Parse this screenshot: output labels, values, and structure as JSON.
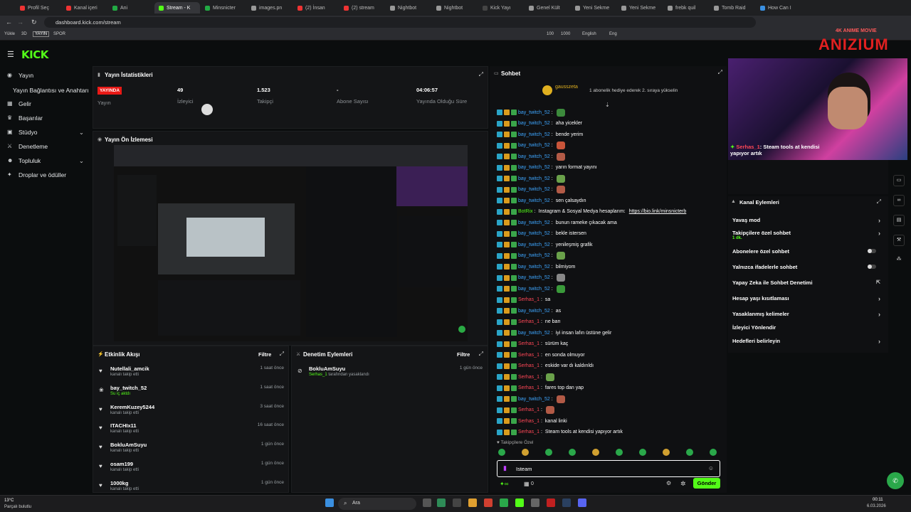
{
  "browser": {
    "tabs": [
      "Profil Seç",
      "Kanal içeri",
      "Ani",
      "Stream - K",
      "Minsnicter",
      "images.pn",
      "(2) İnsan",
      "(2) stream",
      "Nightbot",
      "Nightbot",
      "Kick Yayı",
      "Genel Kült",
      "Yeni Sekme",
      "Yeni Sekme",
      "frebk quil",
      "Tomb Raid",
      "How Can I"
    ],
    "active_tab_index": 3,
    "url": "dashboard.kick.com/stream",
    "bookmarks": [
      "Yükle",
      "3D",
      "YAYIN",
      "SPOR",
      "100",
      "1000",
      "English",
      "Eng"
    ]
  },
  "kick": {
    "logo": "KICK"
  },
  "sidebar": {
    "items": [
      {
        "label": "Yayın",
        "icon": "broadcast-icon"
      },
      {
        "label": "Yayın Bağlantısı ve Anahtarı",
        "icon": ""
      },
      {
        "label": "Gelir",
        "icon": "money-icon"
      },
      {
        "label": "Başarılar",
        "icon": "trophy-icon"
      },
      {
        "label": "Stüdyo",
        "icon": "studio-icon"
      },
      {
        "label": "Denetleme",
        "icon": "sword-icon"
      },
      {
        "label": "Topluluk",
        "icon": "people-icon"
      },
      {
        "label": "Droplar ve ödüller",
        "icon": "gift-icon"
      }
    ]
  },
  "stats": {
    "title": "Yayın İstatistikleri",
    "live_badge": "YAYINDA",
    "live_label": "Yayın",
    "viewers": "49",
    "viewers_label": "İzleyici",
    "followers": "1.523",
    "followers_label": "Takipçi",
    "subs": "-",
    "subs_label": "Abone Sayısı",
    "uptime": "04:06:57",
    "uptime_label": "Yayında Olduğu Süre"
  },
  "preview": {
    "title": "Yayın Ön İzlemesi"
  },
  "activity": {
    "title": "Etkinlik Akışı",
    "filter": "Filtre",
    "items": [
      {
        "name": "Nutellali_amcik",
        "sub": "kanalı takip etti",
        "time": "1 saat önce"
      },
      {
        "name": "bay_twitch_52",
        "sub": "Su iç aktdı",
        "time": "1 saat önce"
      },
      {
        "name": "KeremKuzey5244",
        "sub": "kanalı takip etti",
        "time": "3 saat önce"
      },
      {
        "name": "ITACHIx11",
        "sub": "kanalı takip etti",
        "time": "16 saat önce"
      },
      {
        "name": "BokluAmSuyu",
        "sub": "kanalı takip etti",
        "time": "1 gün önce"
      },
      {
        "name": "osam199",
        "sub": "kanalı takip etti",
        "time": "1 gün önce"
      },
      {
        "name": "1000kg",
        "sub": "kanalı takip etti",
        "time": "1 gün önce"
      }
    ]
  },
  "moderation": {
    "title": "Denetim Eylemleri",
    "filter": "Filtre",
    "items": [
      {
        "name": "BokluAmSuyu",
        "by": "Serhas_1",
        "sub": "tarafından yasaklandı",
        "time": "1 gün önce"
      }
    ]
  },
  "chat": {
    "title": "Sohbet",
    "pinned_user": "gausszeta",
    "pinned_msg": "1 abonelik hediye ederek 2. sıraya yükselin",
    "messages": [
      {
        "user": "bay_twitch_52",
        "text": "",
        "emote": "#3c8a3c",
        "c": "u1"
      },
      {
        "user": "bay_twitch_52",
        "text": "aha yicekler",
        "emote": "",
        "c": "u1"
      },
      {
        "user": "bay_twitch_52",
        "text": "bende yerim",
        "emote": "",
        "c": "u1"
      },
      {
        "user": "bay_twitch_52",
        "text": "",
        "emote": "#c9553a",
        "c": "u1"
      },
      {
        "user": "bay_twitch_52",
        "text": "",
        "emote": "#b25a46",
        "c": "u1"
      },
      {
        "user": "bay_twitch_52",
        "text": "yarın format yayını",
        "emote": "",
        "c": "u1"
      },
      {
        "user": "bay_twitch_52",
        "text": "",
        "emote": "#6aa14a",
        "c": "u1"
      },
      {
        "user": "bay_twitch_52",
        "text": "",
        "emote": "#b25a46",
        "c": "u1"
      },
      {
        "user": "bay_twitch_52",
        "text": "sen çalsaydın",
        "emote": "",
        "c": "u1"
      },
      {
        "user": "BotRix",
        "text": "Instagram & Sosyal Medya hesaplarım:",
        "link": "https://bio.link/minsnicterb",
        "emote": "",
        "c": "u3"
      },
      {
        "user": "bay_twitch_52",
        "text": "bunun rameke çıkacak ama",
        "emote": "",
        "c": "u1"
      },
      {
        "user": "bay_twitch_52",
        "text": "bekle istersen",
        "emote": "",
        "c": "u1"
      },
      {
        "user": "bay_twitch_52",
        "text": "yenileşmiş grafik",
        "emote": "",
        "c": "u1"
      },
      {
        "user": "bay_twitch_52",
        "text": "",
        "emote": "#6aa14a",
        "c": "u1"
      },
      {
        "user": "bay_twitch_52",
        "text": "bilmiyom",
        "emote": "",
        "c": "u1"
      },
      {
        "user": "bay_twitch_52",
        "text": "",
        "emote": "#888",
        "c": "u1"
      },
      {
        "user": "bay_twitch_52",
        "text": "",
        "emote": "#3a9a3a",
        "c": "u1"
      },
      {
        "user": "Serhas_1",
        "text": "sa",
        "emote": "",
        "c": "u2"
      },
      {
        "user": "bay_twitch_52",
        "text": "as",
        "emote": "",
        "c": "u1"
      },
      {
        "user": "Serhas_1",
        "text": "ne barı",
        "emote": "",
        "c": "u2"
      },
      {
        "user": "bay_twitch_52",
        "text": "iyi insan lafın üstüne gelir",
        "emote": "",
        "c": "u1"
      },
      {
        "user": "Serhas_1",
        "text": "sürüm kaç",
        "emote": "",
        "c": "u2"
      },
      {
        "user": "Serhas_1",
        "text": "en sonda olmuyor",
        "emote": "",
        "c": "u2"
      },
      {
        "user": "Serhas_1",
        "text": "eskide var dı kaldırıldı",
        "emote": "",
        "c": "u2"
      },
      {
        "user": "Serhas_1",
        "text": "",
        "emote": "#6aa14a",
        "c": "u2"
      },
      {
        "user": "Serhas_1",
        "text": "fares top dan yap",
        "emote": "",
        "c": "u2"
      },
      {
        "user": "bay_twitch_52",
        "text": "",
        "emote": "#b25a46",
        "c": "u1"
      },
      {
        "user": "Serhas_1",
        "text": "",
        "emote": "#b25a46",
        "c": "u2"
      },
      {
        "user": "Serhas_1",
        "text": "kanal linki",
        "emote": "",
        "c": "u2"
      },
      {
        "user": "Serhas_1",
        "text": "Steam tools at kendisi yapıyor artık",
        "emote": "",
        "c": "u2"
      }
    ],
    "followers_only": "Takipçilere Özel",
    "input_value": "Isteam",
    "count": "0",
    "send": "Gönder"
  },
  "overlay": {
    "brand": "ANIZIUM",
    "brand_sub": "4K ANIME MOVIE",
    "cam_user": "Serhas_1",
    "cam_msg": ": Steam tools at kendisi yapıyor artık"
  },
  "channel_actions": {
    "title": "Kanal Eylemleri",
    "items": [
      {
        "label": "Yavaş mod",
        "ctrl": "arrow"
      },
      {
        "label": "Takipçilere özel sohbet",
        "sub": "1 dk.",
        "ctrl": "arrow"
      },
      {
        "label": "Abonelere özel sohbet",
        "ctrl": "toggle"
      },
      {
        "label": "Yalnızca ifadelerle sohbet",
        "ctrl": "toggle"
      },
      {
        "label": "Yapay Zeka ile Sohbet Denetimi",
        "ctrl": "ext"
      },
      {
        "label": "Hesap yaşı kısıtlaması",
        "ctrl": "arrow"
      },
      {
        "label": "Yasaklanmış kelimeler",
        "ctrl": "arrow"
      },
      {
        "label": "İzleyici Yönlendir",
        "ctrl": ""
      },
      {
        "label": "Hedefleri belirleyin",
        "ctrl": "arrow"
      }
    ]
  },
  "taskbar": {
    "weather_temp": "13°C",
    "weather_desc": "Parçalı bulutlu",
    "search": "Ara",
    "time": "00:11",
    "date": "6.03.2026"
  }
}
